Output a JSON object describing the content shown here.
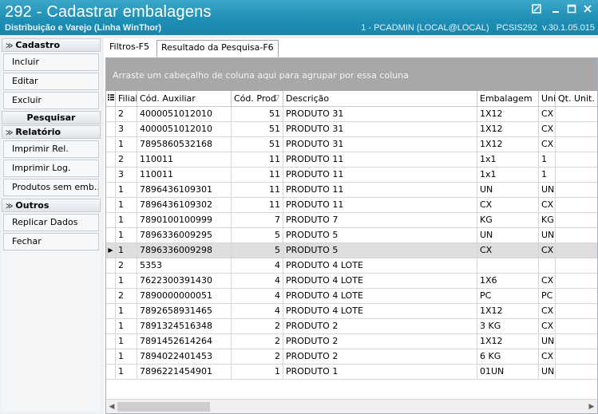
{
  "window": {
    "title": "292 - Cadastrar embalagens",
    "subtitle": "Distribuição e Varejo (Linha WinThor)",
    "status": "1 - PCADMIN (LOCAL@LOCAL)   PCSIS292  v.30.1.05.015"
  },
  "sidebar": {
    "cadastro_label": "Cadastro",
    "incluir": "Incluir",
    "editar": "Editar",
    "excluir": "Excluir",
    "pesquisar": "Pesquisar",
    "relatorio_label": "Relatório",
    "imprimir_rel": "Imprimir Rel.",
    "imprimir_log": "Imprimir Log.",
    "produtos_sem_emb": "Produtos sem emb...",
    "outros_label": "Outros",
    "replicar": "Replicar Dados",
    "fechar": "Fechar"
  },
  "tabs": {
    "filtros": "Filtros-F5",
    "resultado": "Resultado da Pesquisa-F6"
  },
  "grid": {
    "group_hint": "Arraste um cabeçalho de coluna aqui para agrupar por essa coluna",
    "headers": {
      "filial": "Filial",
      "cod_aux": "Cód. Auxiliar",
      "cod_prod": "Cód. Prod",
      "descricao": "Descrição",
      "embalagem": "Embalagem",
      "unidade": "Unid",
      "qt_unit": "Qt. Unit."
    },
    "rows": [
      {
        "filial": "2",
        "cod_aux": "4000051012010",
        "cod_prod": "51",
        "descricao": "PRODUTO 31",
        "embalagem": "1X12",
        "unidade": "CX"
      },
      {
        "filial": "3",
        "cod_aux": "4000051012010",
        "cod_prod": "51",
        "descricao": "PRODUTO 31",
        "embalagem": "1X12",
        "unidade": "CX"
      },
      {
        "filial": "1",
        "cod_aux": "7895860532168",
        "cod_prod": "51",
        "descricao": "PRODUTO 31",
        "embalagem": "1X12",
        "unidade": "CX"
      },
      {
        "filial": "2",
        "cod_aux": "110011",
        "cod_prod": "11",
        "descricao": "PRODUTO 11",
        "embalagem": "1x1",
        "unidade": "1"
      },
      {
        "filial": "3",
        "cod_aux": "110011",
        "cod_prod": "11",
        "descricao": "PRODUTO 11",
        "embalagem": "1x1",
        "unidade": "1"
      },
      {
        "filial": "1",
        "cod_aux": "7896436109301",
        "cod_prod": "11",
        "descricao": "PRODUTO 11",
        "embalagem": "UN",
        "unidade": "UN"
      },
      {
        "filial": "1",
        "cod_aux": "7896436109302",
        "cod_prod": "11",
        "descricao": "PRODUTO 11",
        "embalagem": "CX",
        "unidade": "CX"
      },
      {
        "filial": "1",
        "cod_aux": "7890100100999",
        "cod_prod": "7",
        "descricao": "PRODUTO 7",
        "embalagem": "KG",
        "unidade": "KG"
      },
      {
        "filial": "1",
        "cod_aux": "7896336009295",
        "cod_prod": "5",
        "descricao": "PRODUTO 5",
        "embalagem": "UN",
        "unidade": "UN"
      },
      {
        "filial": "1",
        "cod_aux": "7896336009298",
        "cod_prod": "5",
        "descricao": "PRODUTO 5",
        "embalagem": "CX",
        "unidade": "CX"
      },
      {
        "filial": "2",
        "cod_aux": "5353",
        "cod_prod": "4",
        "descricao": "PRODUTO 4 LOTE",
        "embalagem": "",
        "unidade": ""
      },
      {
        "filial": "1",
        "cod_aux": "7622300391430",
        "cod_prod": "4",
        "descricao": "PRODUTO 4 LOTE",
        "embalagem": "1X6",
        "unidade": "CX"
      },
      {
        "filial": "2",
        "cod_aux": "7890000000051",
        "cod_prod": "4",
        "descricao": "PRODUTO 4 LOTE",
        "embalagem": "PC",
        "unidade": "PC"
      },
      {
        "filial": "1",
        "cod_aux": "7892658931465",
        "cod_prod": "4",
        "descricao": "PRODUTO 4 LOTE",
        "embalagem": "1X12",
        "unidade": "CX"
      },
      {
        "filial": "1",
        "cod_aux": "7891324516348",
        "cod_prod": "2",
        "descricao": "PRODUTO 2",
        "embalagem": "3 KG",
        "unidade": "CX"
      },
      {
        "filial": "1",
        "cod_aux": "7891452614264",
        "cod_prod": "2",
        "descricao": "PRODUTO 2",
        "embalagem": "1X12",
        "unidade": "UN"
      },
      {
        "filial": "1",
        "cod_aux": "7894022401453",
        "cod_prod": "2",
        "descricao": "PRODUTO 2",
        "embalagem": "6 KG",
        "unidade": "CX"
      },
      {
        "filial": "1",
        "cod_aux": "7896221454901",
        "cod_prod": "1",
        "descricao": "PRODUTO 1",
        "embalagem": "01UN",
        "unidade": "UN"
      }
    ]
  }
}
